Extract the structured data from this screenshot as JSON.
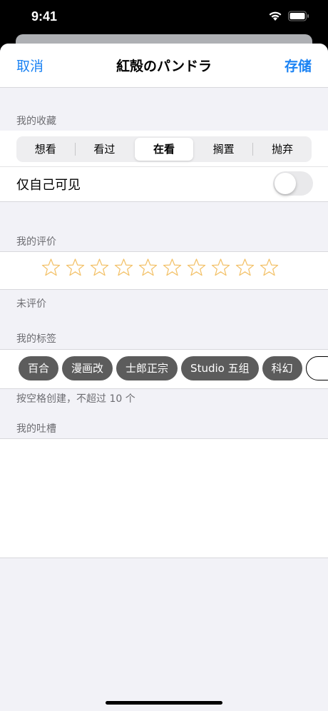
{
  "status": {
    "time": "9:41"
  },
  "nav": {
    "cancel": "取消",
    "title": "紅殻のパンドラ",
    "save": "存储"
  },
  "collection": {
    "header": "我的收藏",
    "segments": [
      "想看",
      "看过",
      "在看",
      "搁置",
      "抛弃"
    ],
    "selected": "在看"
  },
  "privacy": {
    "label": "仅自己可见",
    "enabled": false
  },
  "rating": {
    "header": "我的评价",
    "max_stars": 10,
    "value": 0,
    "status_text": "未评价",
    "star_color": "#f3c168"
  },
  "tags": {
    "header": "我的标签",
    "items": [
      "百合",
      "漫画改",
      "士郎正宗",
      "Studio 五组",
      "科幻"
    ],
    "hint": "按空格创建，不超过 10 个"
  },
  "comment": {
    "header": "我的吐槽",
    "value": ""
  },
  "colors": {
    "accent": "#1a82f3",
    "background": "#f2f2f7",
    "tag_bg": "#5c5c5c"
  }
}
